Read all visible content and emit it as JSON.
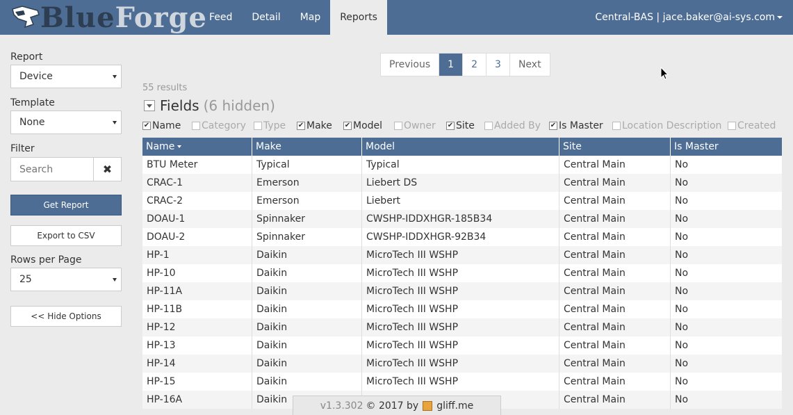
{
  "header": {
    "logo_part1": "Blue",
    "logo_part2": "Forge",
    "nav": [
      "Feed",
      "Detail",
      "Map",
      "Reports"
    ],
    "active_nav": "Reports",
    "user": "Central-BAS | jace.baker@ai-sys.com",
    "colors": {
      "bar": "#4e6d94"
    }
  },
  "sidebar": {
    "report_label": "Report",
    "report_value": "Device",
    "template_label": "Template",
    "template_value": "None",
    "filter_label": "Filter",
    "search_placeholder": "Search",
    "clear_icon": "✖",
    "get_report": "Get Report",
    "export_csv": "Export to CSV",
    "rows_label": "Rows per Page",
    "rows_value": "25",
    "hide_options": "<< Hide Options"
  },
  "pagination": {
    "prev": "Previous",
    "pages": [
      "1",
      "2",
      "3"
    ],
    "current": "1",
    "next": "Next"
  },
  "results_text": "55 results",
  "fields": {
    "title": "Fields",
    "hidden_text": "(6 hidden)",
    "items": [
      {
        "label": "Name",
        "checked": true
      },
      {
        "label": "Category",
        "checked": false
      },
      {
        "label": "Type",
        "checked": false
      },
      {
        "label": "Make",
        "checked": true
      },
      {
        "label": "Model",
        "checked": true
      },
      {
        "label": "Owner",
        "checked": false
      },
      {
        "label": "Site",
        "checked": true
      },
      {
        "label": "Added By",
        "checked": false
      },
      {
        "label": "Is Master",
        "checked": true
      },
      {
        "label": "Location Description",
        "checked": false
      },
      {
        "label": "Created",
        "checked": false
      }
    ]
  },
  "table": {
    "columns": [
      "Name",
      "Make",
      "Model",
      "Site",
      "Is Master"
    ],
    "rows": [
      [
        "BTU Meter",
        "Typical",
        "Typical",
        "Central Main",
        "No"
      ],
      [
        "CRAC-1",
        "Emerson",
        "Liebert DS",
        "Central Main",
        "No"
      ],
      [
        "CRAC-2",
        "Emerson",
        "Liebert",
        "Central Main",
        "No"
      ],
      [
        "DOAU-1",
        "Spinnaker",
        "CWSHP-IDDXHGR-185B34",
        "Central Main",
        "No"
      ],
      [
        "DOAU-2",
        "Spinnaker",
        "CWSHP-IDDXHGR-92B34",
        "Central Main",
        "No"
      ],
      [
        "HP-1",
        "Daikin",
        "MicroTech III WSHP",
        "Central Main",
        "No"
      ],
      [
        "HP-10",
        "Daikin",
        "MicroTech III WSHP",
        "Central Main",
        "No"
      ],
      [
        "HP-11A",
        "Daikin",
        "MicroTech III WSHP",
        "Central Main",
        "No"
      ],
      [
        "HP-11B",
        "Daikin",
        "MicroTech III WSHP",
        "Central Main",
        "No"
      ],
      [
        "HP-12",
        "Daikin",
        "MicroTech III WSHP",
        "Central Main",
        "No"
      ],
      [
        "HP-13",
        "Daikin",
        "MicroTech III WSHP",
        "Central Main",
        "No"
      ],
      [
        "HP-14",
        "Daikin",
        "MicroTech III WSHP",
        "Central Main",
        "No"
      ],
      [
        "HP-15",
        "Daikin",
        "MicroTech III WSHP",
        "Central Main",
        "No"
      ],
      [
        "HP-16A",
        "Daikin",
        "",
        "Central Main",
        "No"
      ]
    ]
  },
  "footer": {
    "version": "v1.3.302",
    "copyright": "© 2017 by",
    "brand": "gliff.me"
  }
}
